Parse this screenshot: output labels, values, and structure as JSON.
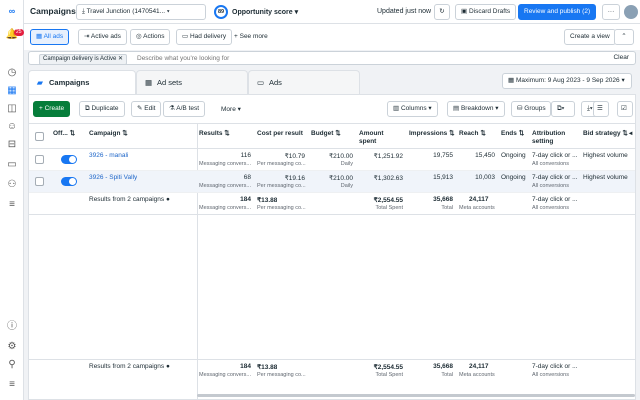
{
  "nav": {
    "notifications_count": "25",
    "icons": [
      "meta-logo-icon",
      "notifications-icon",
      "account-icon",
      "dashboard-icon",
      "campaigns-icon",
      "audiences-icon",
      "ads-manager-icon",
      "billing-icon",
      "business-icon",
      "menu-icon",
      "help-icon",
      "settings-icon",
      "search-icon",
      "more-icon"
    ]
  },
  "header": {
    "title": "Campaigns",
    "account_name": "Travel Junction (1470541...",
    "opportunity_score_value": "89",
    "opportunity_score_label": "Opportunity score",
    "updated_text": "Updated just now",
    "discard_label": "Discard Drafts",
    "review_label": "Review and publish (2)",
    "more_label": "···"
  },
  "views": {
    "all_ads": "All ads",
    "active_ads": "Active ads",
    "actions": "Actions",
    "had_delivery": "Had delivery",
    "see_more": "See more",
    "create_view": "Create a view"
  },
  "filter": {
    "chip": "Campaign delivery is Active",
    "placeholder": "Describe what you're looking for",
    "clear": "Clear"
  },
  "tabs": {
    "campaigns": "Campaigns",
    "ad_sets": "Ad sets",
    "ads": "Ads",
    "date_range": "Maximum: 9 Aug 2023 - 9 Sep 2026"
  },
  "actions": {
    "create": "Create",
    "duplicate": "Duplicate",
    "edit": "Edit",
    "ab_test": "A/B test",
    "more": "More",
    "columns": "Columns",
    "breakdown": "Breakdown",
    "groups": "Groups"
  },
  "columns": {
    "off_on": "Off...",
    "campaign": "Campaign",
    "results": "Results",
    "cost_per_result": "Cost per result",
    "budget": "Budget",
    "amount_spent": "Amount spent",
    "impressions": "Impressions",
    "reach": "Reach",
    "ends": "Ends",
    "attribution": "Attribution setting",
    "bid_strategy": "Bid strategy"
  },
  "rows": [
    {
      "name": "3926 - manali",
      "results": "116",
      "results_sub": "Messaging convers...",
      "cost": "₹10.79",
      "cost_sub": "Per messaging co...",
      "budget": "₹210.00",
      "budget_sub": "Daily",
      "spent": "₹1,251.92",
      "impressions": "19,755",
      "reach": "15,450",
      "ends": "Ongoing",
      "attribution": "7-day click or ...",
      "attribution_sub": "All conversions",
      "bid": "Highest volume"
    },
    {
      "name": "3926 - Spiti Vally",
      "results": "68",
      "results_sub": "Messaging convers...",
      "cost": "₹19.16",
      "cost_sub": "Per messaging co...",
      "budget": "₹210.00",
      "budget_sub": "Daily",
      "spent": "₹1,302.63",
      "impressions": "15,913",
      "reach": "10,003",
      "ends": "Ongoing",
      "attribution": "7-day click or ...",
      "attribution_sub": "All conversions",
      "bid": "Highest volume"
    }
  ],
  "totals": {
    "label": "Results from 2 campaigns",
    "results": "184",
    "results_sub": "Messaging convers...",
    "cost": "₹13.88",
    "cost_sub": "Per messaging co...",
    "spent": "₹2,554.55",
    "spent_sub": "Total Spent",
    "impressions": "35,668",
    "impressions_sub": "Total",
    "reach": "24,117",
    "reach_sub": "Meta accounts",
    "attribution": "7-day click or ...",
    "attribution_sub": "All conversions"
  }
}
